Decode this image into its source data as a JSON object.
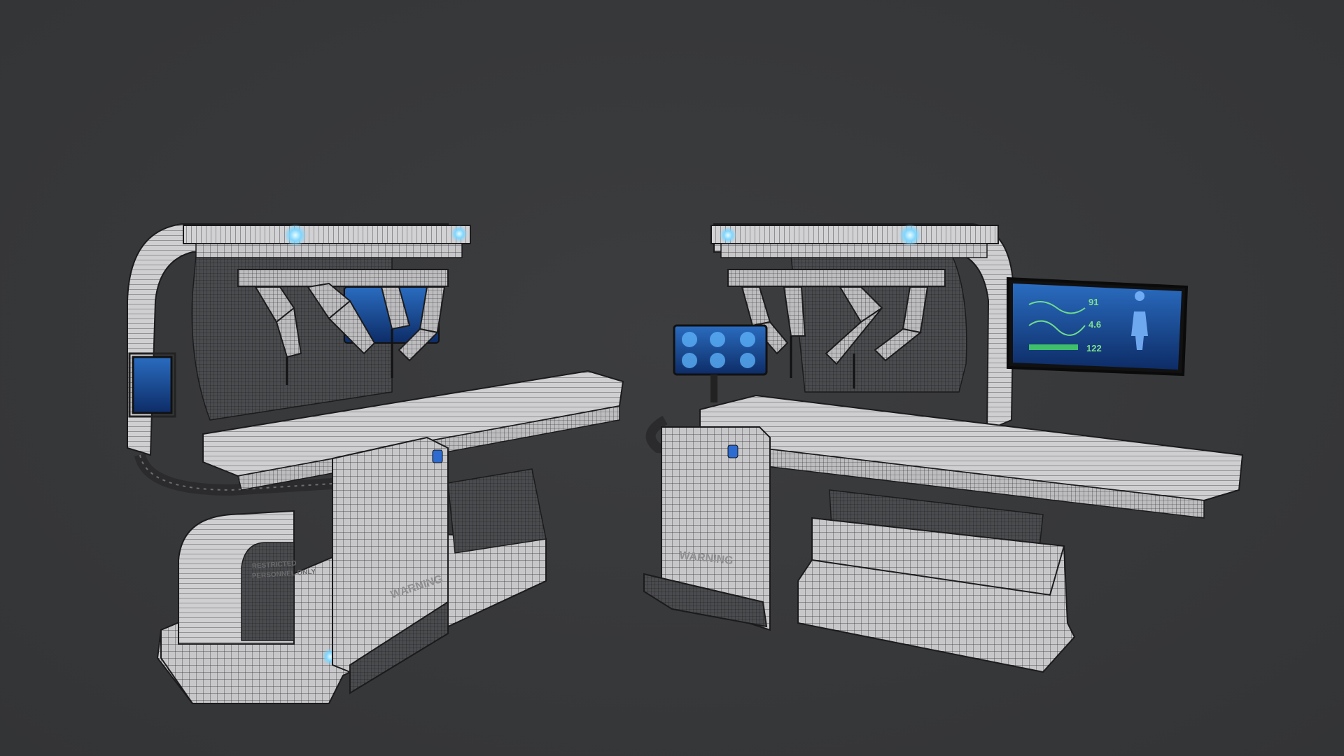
{
  "scene": {
    "background_color": "#38393b",
    "wire_color": "#1c1c1e",
    "body_color": "#c9c9cb",
    "screen_color": "#1d5aa8",
    "glow_color": "#7fd6ff"
  },
  "left_robot": {
    "decal_restricted": "RESTRICTED",
    "decal_personnel": "PERSONNEL ONLY",
    "decal_warning": "WARNING"
  },
  "right_robot": {
    "decal_warning": "WARNING",
    "monitor": {
      "value_1": "91",
      "value_2": "4.6",
      "value_3": "122"
    }
  }
}
